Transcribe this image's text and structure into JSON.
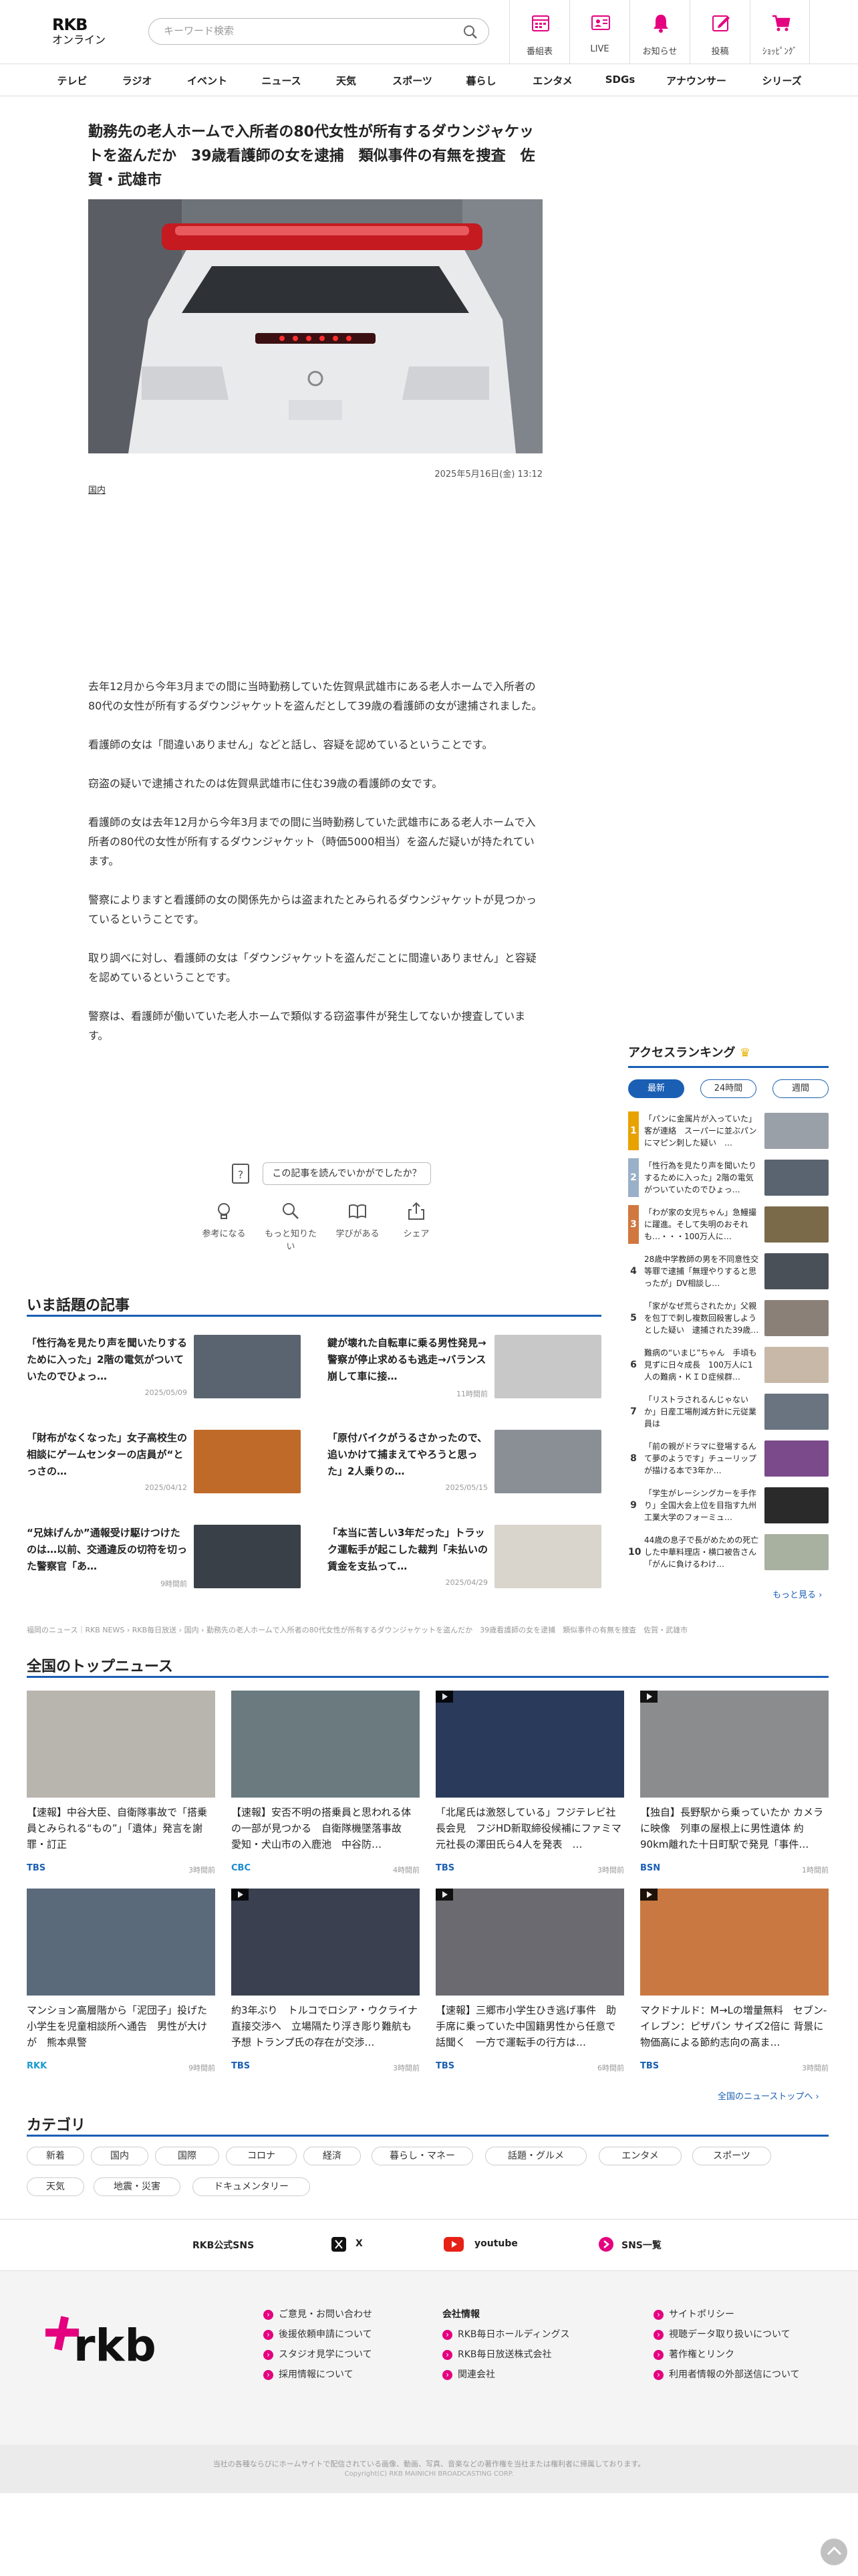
{
  "header": {
    "logo_top": "RKB",
    "logo_bottom": "オンライン",
    "search_placeholder": "キーワード検索",
    "nav": [
      {
        "label": "番組表",
        "icon": "calendar-icon"
      },
      {
        "label": "LIVE",
        "icon": "live-icon"
      },
      {
        "label": "お知らせ",
        "icon": "bell-icon"
      },
      {
        "label": "投稿",
        "icon": "post-icon"
      },
      {
        "label": "ｼｮｯﾋﾟﾝｸﾞ",
        "icon": "cart-icon"
      }
    ],
    "accent": "#e4007f"
  },
  "global_nav": [
    "テレビ",
    "ラジオ",
    "イベント",
    "ニュース",
    "天気",
    "スポーツ",
    "暮らし",
    "エンタメ",
    "SDGs",
    "アナウンサー",
    "シリーズ"
  ],
  "article": {
    "title": "勤務先の老人ホームで入所者の80代女性が所有するダウンジャケットを盗んだか　39歳看護師の女を逮捕　類似事件の有無を捜査　佐賀・武雄市",
    "date": "2025年5月16日(金) 13:12",
    "category": "国内",
    "paragraphs": [
      "去年12月から今年3月までの間に当時勤務していた佐賀県武雄市にある老人ホームで入所者の80代の女性が所有するダウンジャケットを盗んだとして39歳の看護師の女が逮捕されました。",
      "看護師の女は「間違いありません」などと話し、容疑を認めているということです。",
      "窃盗の疑いで逮捕されたのは佐賀県武雄市に住む39歳の看護師の女です。",
      "看護師の女は去年12月から今年3月までの間に当時勤務していた武雄市にある老人ホームで入所者の80代の女性が所有するダウンジャケット（時価5000相当）を盗んだ疑いが持たれています。",
      "警察によりますと看護師の女の関係先からは盗まれたとみられるダウンジャケットが見つかっているということです。",
      "取り調べに対し、看護師の女は「ダウンジャケットを盗んだことに間違いありません」と容疑を認めているということです。",
      "警察は、看護師が働いていた老人ホームで類似する窃盗事件が発生してないか捜査しています。"
    ],
    "feedback_prompt": "この記事を読んでいかがでしたか？",
    "reactions": [
      {
        "label": "参考になる",
        "icon": "bulb-icon"
      },
      {
        "label": "もっと知りたい",
        "icon": "magnifier-icon"
      },
      {
        "label": "学びがある",
        "icon": "book-icon"
      },
      {
        "label": "シェア",
        "icon": "share-icon"
      }
    ]
  },
  "trending": {
    "heading": "いま話題の記事",
    "items": [
      {
        "title": "「性行為を見たり声を聞いたりするために入った」2階の電気がついていたのでひょっ…",
        "date": "2025/05/09",
        "thumb": "#5a6470"
      },
      {
        "title": "鍵が壊れた自転車に乗る男性発見→警察が停止求めるも逃走→バランス崩して車に接…",
        "date": "11時間前",
        "thumb": "#c8c8c8"
      },
      {
        "title": "「財布がなくなった」女子高校生の相談にゲームセンターの店員が“とっさの…",
        "date": "2025/04/12",
        "thumb": "#c06a2a"
      },
      {
        "title": "「原付バイクがうるさかったので、追いかけて捕まえてやろうと思った」2人乗りの…",
        "date": "2025/05/15",
        "thumb": "#8a8f96"
      },
      {
        "title": "“兄妹げんか”通報受け駆けつけたのは…以前、交通違反の切符を切った警察官「あ…",
        "date": "9時間前",
        "thumb": "#3a4048"
      },
      {
        "title": "「本当に苦しい3年だった」トラック運転手が起こした裁判「未払いの賃金を支払って…",
        "date": "2025/04/29",
        "thumb": "#d9d4cc"
      }
    ]
  },
  "ranking": {
    "heading": "アクセスランキング",
    "crown_icon": "crown-icon",
    "tabs": [
      "最新",
      "24時間",
      "週間"
    ],
    "more": "もっと見る ›",
    "items": [
      {
        "rank": "1",
        "title": "「パンに金属片が入っていた」客が連絡　スーパーに並ぶパンにマピン刺した疑い　…",
        "thumb": "#9aa0a8"
      },
      {
        "rank": "2",
        "title": "「性行為を見たり声を聞いたりするために入った」2階の電気がついていたのでひょっ…",
        "thumb": "#5a6470"
      },
      {
        "rank": "3",
        "title": "「わが家の女児ちゃん」急鰻撮に躍進。そして失明のおそれも…・・・100万人に…",
        "thumb": "#7a6a4a"
      },
      {
        "rank": "4",
        "title": "28歳中学教師の男を不同意性交等罪で逮捕「無理やりすると思ったが」DV相談し…",
        "thumb": "#4a5058"
      },
      {
        "rank": "5",
        "title": "「家がなぜ荒らされたか」父親を包丁で刺し複数回殺害しようとした疑い　逮捕された39歳…",
        "thumb": "#8a8078"
      },
      {
        "rank": "6",
        "title": "難病の“いまじ”ちゃん　手頃も見ずに日々成長　100万人に1人の難病・ＫＩＤ症候群…",
        "thumb": "#c8b8a8"
      },
      {
        "rank": "7",
        "title": "「リストラされるんじゃないか」日産工場削減方針に元従業員は",
        "thumb": "#6a7480"
      },
      {
        "rank": "8",
        "title": "「前の親がドラマに登場するんて夢のようです」チューリップが描ける本で3年か…",
        "thumb": "#7a4a8a"
      },
      {
        "rank": "9",
        "title": "「学生がレーシングカーを手作り」全国大会上位を目指す九州工業大学のフォーミュ…",
        "thumb": "#2a2a2a"
      },
      {
        "rank": "10",
        "title": "44歳の息子で長がめための死亡した中華料理店・横口被告さん「がんに負けるわけ…",
        "thumb": "#a8b0a0"
      }
    ]
  },
  "breadcrumb": "福岡のニュース｜RKB NEWS › RKB毎日放送 › 国内 › 勤務先の老人ホームで入所者の80代女性が所有するダウンジャケットを盗んだか　39歳看護師の女を逮捕　類似事件の有無を捜査　佐賀・武雄市",
  "national": {
    "heading": "全国のトップニュース",
    "more": "全国のニューストップへ ›",
    "items": [
      {
        "title": "【速報】中谷大臣、自衛隊事故で「搭乗員とみられる“もの”」「遺体」発言を謝罪・訂正",
        "source": "TBS",
        "source_color": "#1a5fb4",
        "time": "3時間前",
        "thumb": "#b8b4ae",
        "video": "false"
      },
      {
        "title": "【速報】安否不明の搭乗員と思われる体の一部が見つかる　自衛隊機墜落事故　愛知・犬山市の入鹿池　中谷防…",
        "source": "CBC",
        "source_color": "#1a8ad0",
        "time": "4時間前",
        "thumb": "#6a7a7e",
        "video": "false"
      },
      {
        "title": "「北尾氏は激怒している」フジテレビ社長会見　フジHD新取締役候補にファミマ元社長の澤田氏ら4人を発表　…",
        "source": "TBS",
        "source_color": "#1a5fb4",
        "time": "3時間前",
        "thumb": "#2a3a5a",
        "video": "true"
      },
      {
        "title": "【独自】長野駅から乗っていたか カメラに映像　列車の屋根上に男性遺体 約90km離れた十日町駅で発見「事件…",
        "source": "BSN",
        "source_color": "#1a5fb4",
        "time": "1時間前",
        "thumb": "#8a8c8e",
        "video": "true"
      },
      {
        "title": "マンション高層階から「泥団子」投げた小学生を児童相談所へ通告　男性が大けが　熊本県警",
        "source": "RKK",
        "source_color": "#1a9ad0",
        "time": "9時間前",
        "thumb": "#5a6a7a",
        "video": "false"
      },
      {
        "title": "約3年ぶり　トルコでロシア・ウクライナ直接交渉へ　立場隔たり浮き彫り難航も予想 トランプ氏の存在が交渉…",
        "source": "TBS",
        "source_color": "#1a5fb4",
        "time": "3時間前",
        "thumb": "#3a4050",
        "video": "true"
      },
      {
        "title": "【速報】三郷市小学生ひき逃げ事件　助手席に乗っていた中国籍男性から任意で話聞く　一方で運転手の行方は…",
        "source": "TBS",
        "source_color": "#1a5fb4",
        "time": "6時間前",
        "thumb": "#6a6a70",
        "video": "true"
      },
      {
        "title": "マクドナルド：M→Lの増量無料　セブン-イレブン：ピザパン サイズ2倍に 背景に物価高による節約志向の高ま…",
        "source": "TBS",
        "source_color": "#1a5fb4",
        "time": "3時間前",
        "thumb": "#c87840",
        "video": "true"
      }
    ]
  },
  "categories": {
    "heading": "カテゴリ",
    "chips": [
      "新着",
      "国内",
      "国際",
      "コロナ",
      "経済",
      "暮らし・マネー",
      "話題・グルメ",
      "エンタメ",
      "スポーツ",
      "天気",
      "地震・災害",
      "ドキュメンタリー"
    ]
  },
  "sns": {
    "label": "RKB公式SNS",
    "x": "X",
    "youtube": "youtube",
    "list": "SNS一覧"
  },
  "footer": {
    "logo": "rkb",
    "col1": [
      "ご意見・お問い合わせ",
      "後援依頼申請について",
      "スタジオ見学について",
      "採用情報について"
    ],
    "col2_head": "会社情報",
    "col2": [
      "RKB毎日ホールディングス",
      "RKB毎日放送株式会社",
      "関連会社"
    ],
    "col3": [
      "サイトポリシー",
      "視聴データ取り扱いについて",
      "著作権とリンク",
      "利用者情報の外部送信について"
    ],
    "copyright_line1": "当社の各種ならびにホームサイトで配信されている画像、動画、写真、音楽などの著作権を当社または権利者に帰属しております。",
    "copyright_line2": "Copyright(C) RKB MAINICHI BROADCASTING CORP."
  }
}
